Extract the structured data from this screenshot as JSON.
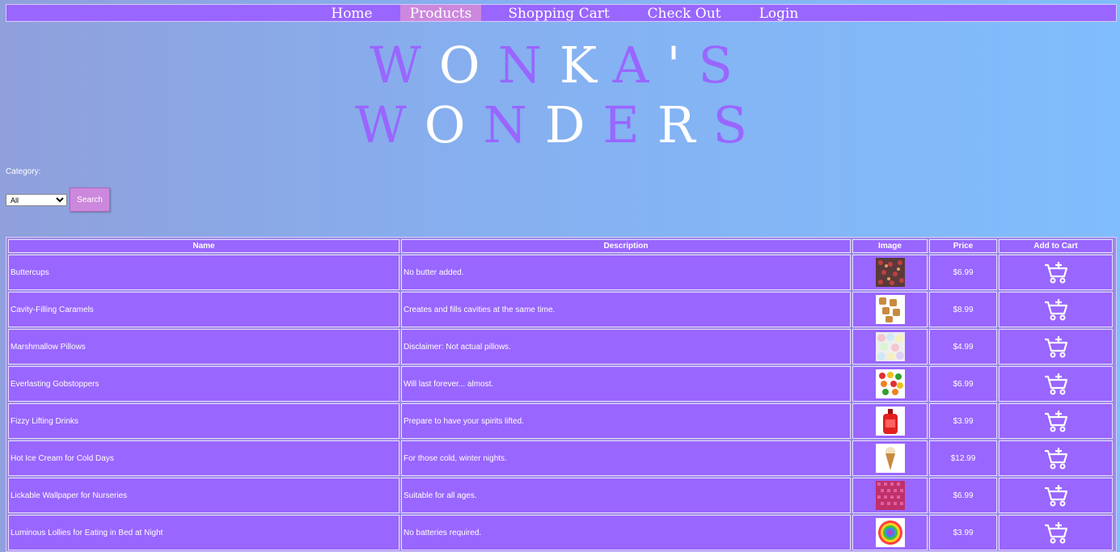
{
  "nav": {
    "items": [
      {
        "label": "Home"
      },
      {
        "label": "Products"
      },
      {
        "label": "Shopping Cart"
      },
      {
        "label": "Check Out"
      },
      {
        "label": "Login"
      }
    ]
  },
  "title": {
    "line1": "WONKA'S",
    "line2": "WONDERS"
  },
  "filter": {
    "category_label": "Category:",
    "selected_category": "All",
    "search_label": "Search"
  },
  "table": {
    "headers": [
      "Name",
      "Description",
      "Image",
      "Price",
      "Add to Cart"
    ],
    "rows": [
      {
        "name": "Buttercups",
        "description": "No butter added.",
        "price": "$6.99",
        "image_icon": "buttercups-image"
      },
      {
        "name": "Cavity-Filling Caramels",
        "description": "Creates and fills cavities at the same time.",
        "price": "$8.99",
        "image_icon": "caramels-image"
      },
      {
        "name": "Marshmallow Pillows",
        "description": "Disclaimer: Not actual pillows.",
        "price": "$4.99",
        "image_icon": "marshmallow-image"
      },
      {
        "name": "Everlasting Gobstoppers",
        "description": "Will last forever... almost.",
        "price": "$6.99",
        "image_icon": "gobstoppers-image"
      },
      {
        "name": "Fizzy Lifting Drinks",
        "description": "Prepare to have your spirits lifted.",
        "price": "$3.99",
        "image_icon": "drink-bottle-image"
      },
      {
        "name": "Hot Ice Cream for Cold Days",
        "description": "For those cold, winter nights.",
        "price": "$12.99",
        "image_icon": "ice-cream-cone-image"
      },
      {
        "name": "Lickable Wallpaper for Nurseries",
        "description": "Suitable for all ages.",
        "price": "$6.99",
        "image_icon": "wallpaper-image"
      },
      {
        "name": "Luminous Lollies for Eating in Bed at Night",
        "description": "No batteries required.",
        "price": "$3.99",
        "image_icon": "lollipop-image"
      }
    ]
  },
  "colors": {
    "purple": "#9966ff",
    "pink_accent": "#cc88dd",
    "white": "#ffffff"
  }
}
